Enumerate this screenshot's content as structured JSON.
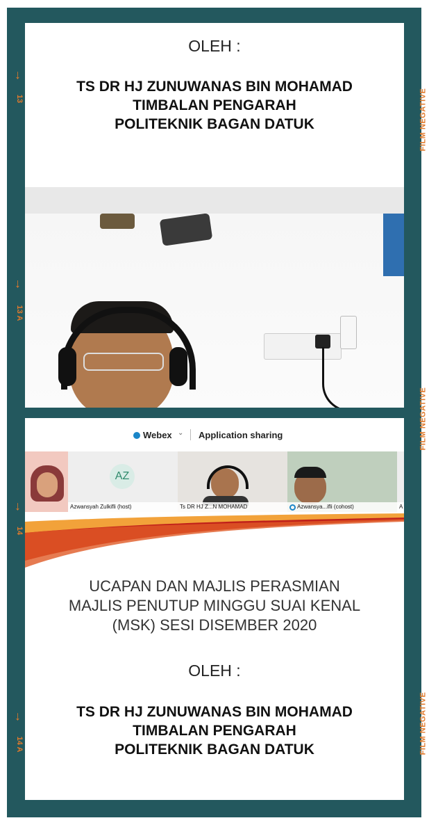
{
  "edge_labels": {
    "film_negative": "FILM NEGATIVE",
    "frame_13": "13",
    "frame_13a": "13 A",
    "frame_14": "14",
    "frame_14a": "14 A",
    "arrow": "→"
  },
  "frame1": {
    "oleh": "OLEH :",
    "name_line1": "TS DR HJ ZUNUWANAS BIN MOHAMAD",
    "name_line2": "TIMBALAN PENGARAH",
    "name_line3": "POLITEKNIK BAGAN DATUK"
  },
  "frame2": {
    "webex_label": "Webex",
    "app_sharing": "Application sharing",
    "participants": [
      {
        "name": "",
        "initials": ""
      },
      {
        "name": "Azwansyah Zulkifli (host)",
        "initials": "AZ"
      },
      {
        "name": "Ts DR HJ Z...N MOHAMAD",
        "initials": ""
      },
      {
        "name": "Azwansya...ifli (cohost)",
        "initials": ""
      },
      {
        "name": "A",
        "initials": ""
      }
    ],
    "title_line1": "UCAPAN DAN MAJLIS PERASMIAN",
    "title_line2": "MAJLIS PENUTUP MINGGU SUAI KENAL",
    "title_line3": "(MSK) SESI DISEMBER 2020",
    "oleh": "OLEH :",
    "name_line1": "TS DR HJ ZUNUWANAS BIN MOHAMAD",
    "name_line2": "TIMBALAN PENGARAH",
    "name_line3": "POLITEKNIK BAGAN DATUK"
  },
  "colors": {
    "film": "#23585e",
    "accent": "#e07a2c",
    "webex_blue": "#1a86c8"
  }
}
